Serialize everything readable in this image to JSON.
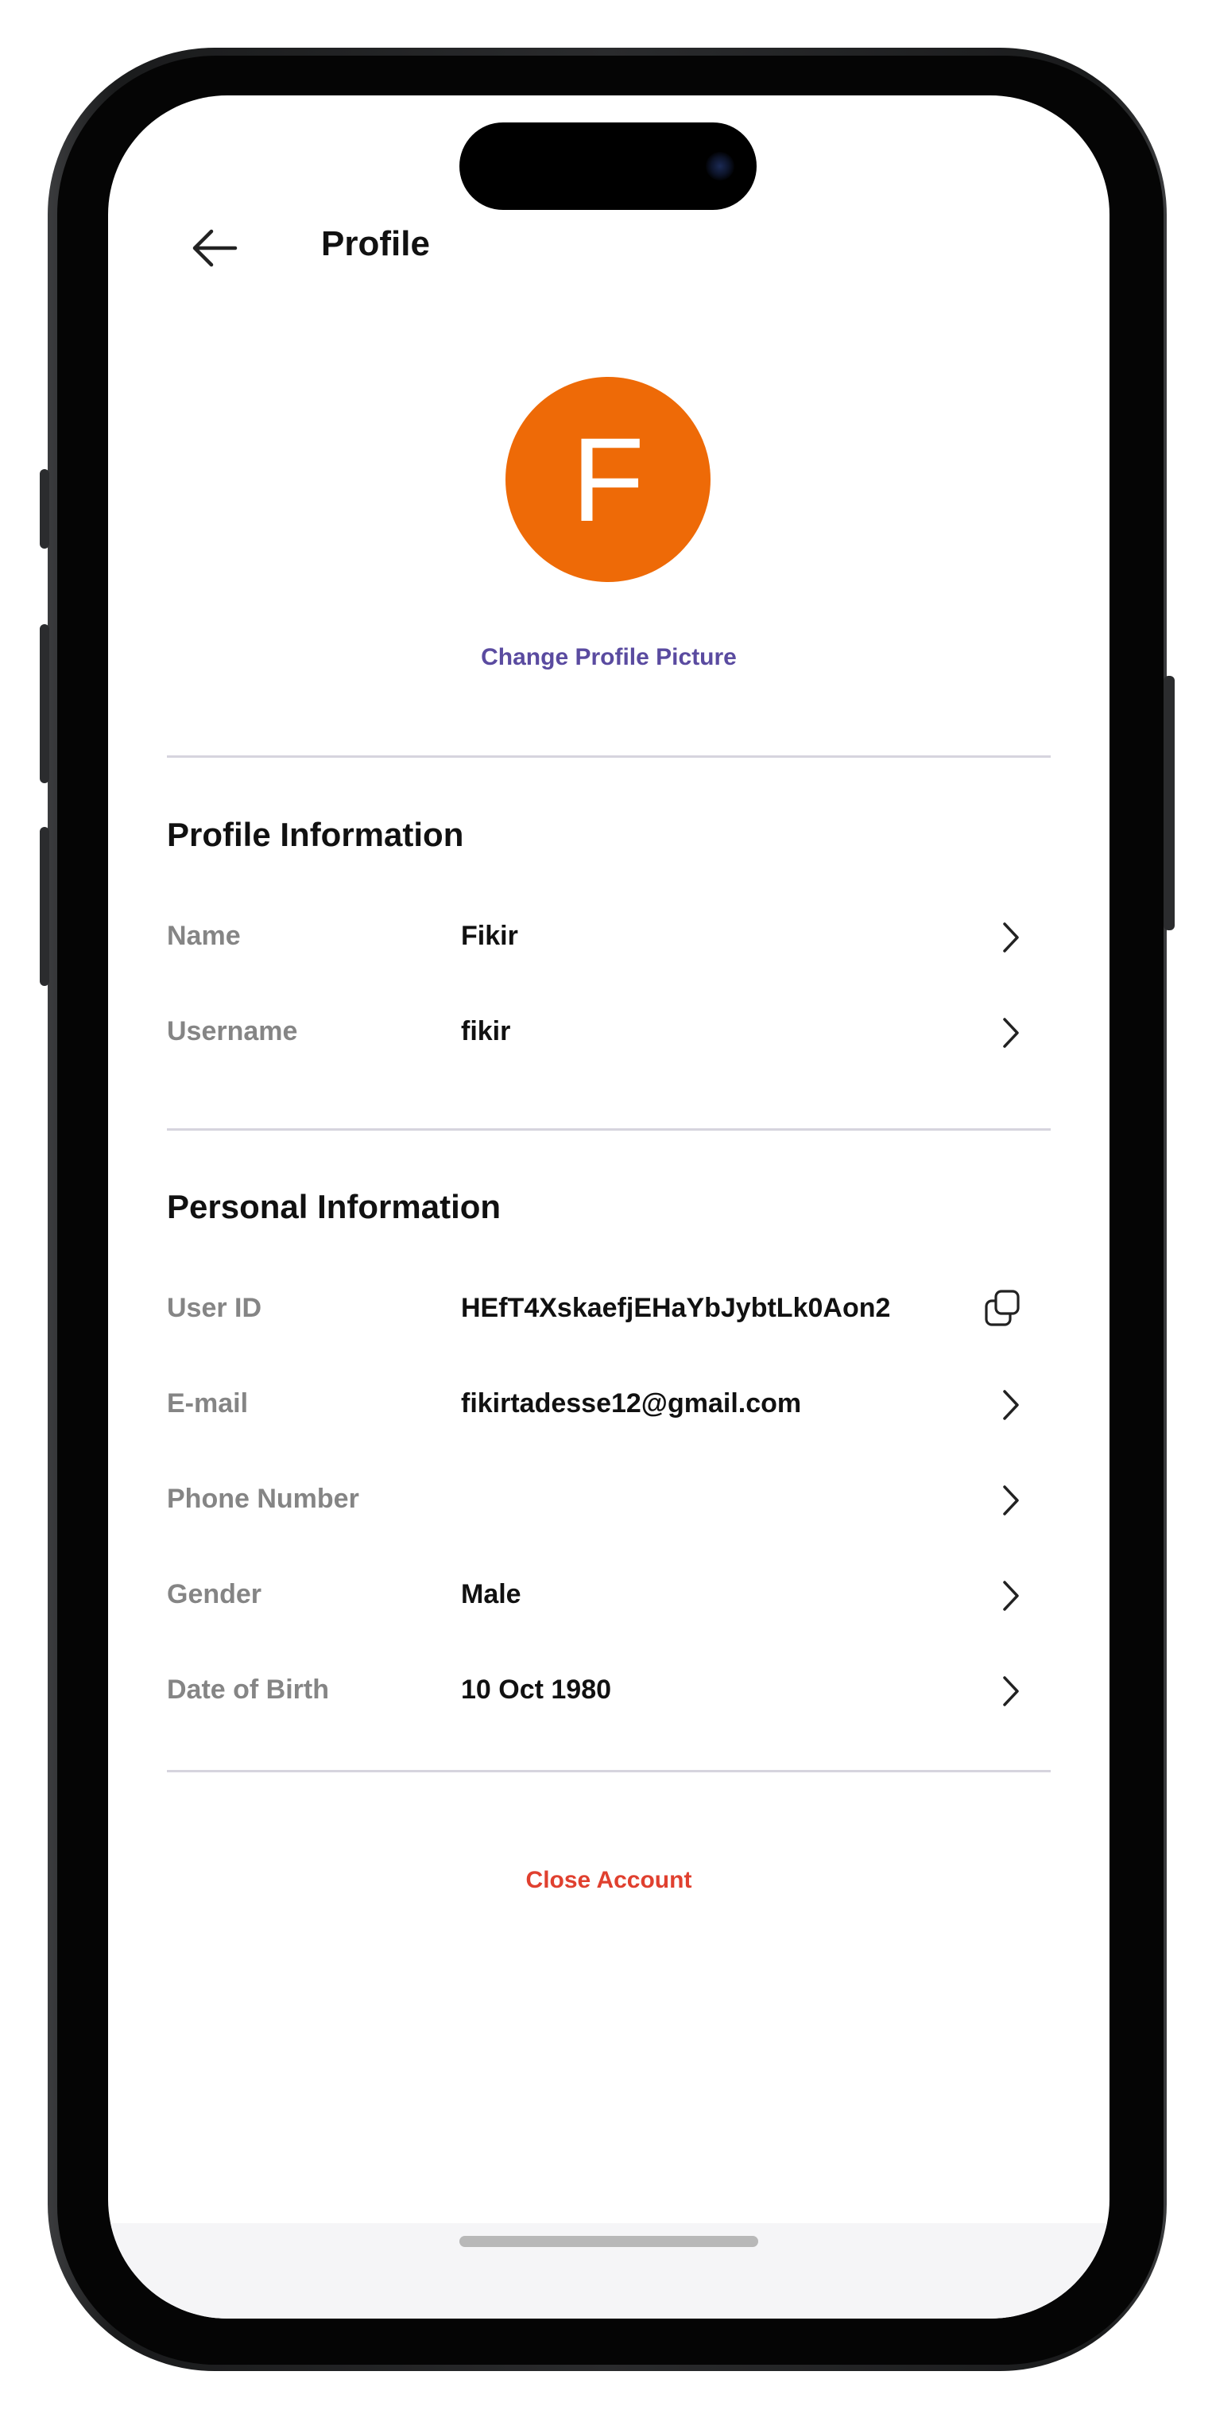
{
  "header": {
    "title": "Profile"
  },
  "avatar": {
    "initial": "F",
    "color": "#ee6a07"
  },
  "change_picture_label": "Change Profile Picture",
  "profile_info": {
    "title": "Profile Information",
    "rows": [
      {
        "label": "Name",
        "value": "Fikir",
        "icon": "chevron-right-icon"
      },
      {
        "label": "Username",
        "value": "fikir",
        "icon": "chevron-right-icon"
      }
    ]
  },
  "personal_info": {
    "title": "Personal Information",
    "rows": [
      {
        "label": "User ID",
        "value": "HEfT4XskaefjEHaYbJybtLk0Aon2",
        "icon": "copy-icon"
      },
      {
        "label": "E-mail",
        "value": "fikirtadesse12@gmail.com",
        "icon": "chevron-right-icon"
      },
      {
        "label": "Phone Number",
        "value": "",
        "icon": "chevron-right-icon"
      },
      {
        "label": "Gender",
        "value": "Male",
        "icon": "chevron-right-icon"
      },
      {
        "label": "Date of Birth",
        "value": "10 Oct 1980",
        "icon": "chevron-right-icon"
      }
    ]
  },
  "close_account_label": "Close Account",
  "colors": {
    "accent": "#5a4ba0",
    "danger": "#e0402f",
    "avatar": "#ee6a07"
  }
}
